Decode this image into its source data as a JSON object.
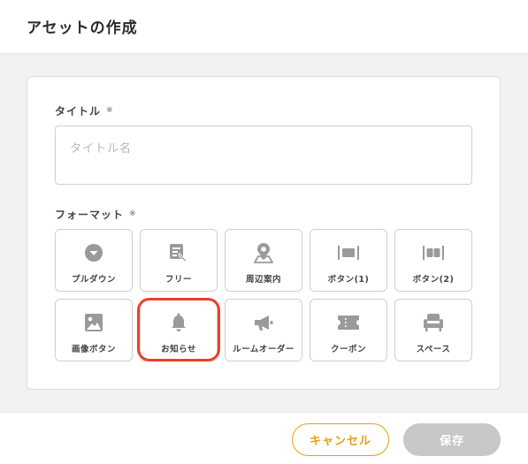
{
  "header": {
    "title": "アセットの作成"
  },
  "form": {
    "title_label": "タイトル",
    "required_mark": "※",
    "title_placeholder": "タイトル名",
    "title_value": "",
    "format_label": "フォーマット"
  },
  "formats": [
    {
      "label": "プルダウン",
      "icon": "chevron-circle-icon"
    },
    {
      "label": "フリー",
      "icon": "free-edit-icon"
    },
    {
      "label": "周辺案内",
      "icon": "map-pin-icon"
    },
    {
      "label": "ボタン(1)",
      "icon": "single-button-icon"
    },
    {
      "label": "ボタン(2)",
      "icon": "double-button-icon"
    },
    {
      "label": "画像ボタン",
      "icon": "image-icon"
    },
    {
      "label": "お知らせ",
      "icon": "bell-icon",
      "highlighted": true
    },
    {
      "label": "ルームオーダー",
      "icon": "megaphone-icon"
    },
    {
      "label": "クーポン",
      "icon": "ticket-icon"
    },
    {
      "label": "スペース",
      "icon": "armchair-icon"
    }
  ],
  "footer": {
    "cancel_label": "キャンセル",
    "save_label": "保存"
  },
  "colors": {
    "accent": "#e6a10e",
    "highlight": "#e8412c",
    "icon_gray": "#9a9a9a",
    "disabled": "#c8c8c8"
  }
}
